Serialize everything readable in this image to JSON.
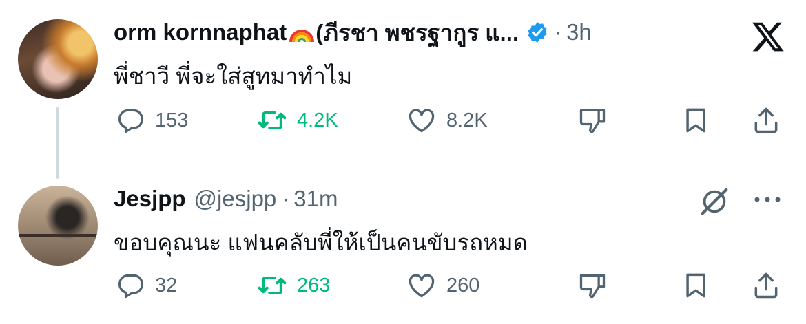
{
  "tweets": [
    {
      "author_name": "orm kornnaphat",
      "author_name_suffix": "(ภีรชา พชรฐากูร แ...",
      "separator": "·",
      "time": "3h",
      "verified": true,
      "text": "พี่ชาวี พี่จะใส่สูทมาทำไม",
      "stats": {
        "replies": "153",
        "reposts": "4.2K",
        "likes": "8.2K"
      }
    },
    {
      "author_name": "Jesjpp",
      "handle": "@jesjpp",
      "separator": "·",
      "time": "31m",
      "text": "ขอบคุณนะ แฟนคลับพี่ให้เป็นคนขับรถหมด",
      "stats": {
        "replies": "32",
        "reposts": "263",
        "likes": "260"
      }
    }
  ],
  "colors": {
    "accent_repost": "#00ba7c",
    "verified": "#1d9bf0",
    "muted": "#536471",
    "thread_line": "#cfd9de"
  },
  "icons": [
    "rainbow-emoji",
    "verified-badge-icon",
    "x-logo-icon",
    "reply-icon",
    "repost-icon",
    "like-icon",
    "dislike-icon",
    "bookmark-icon",
    "share-icon",
    "grok-icon",
    "more-icon"
  ]
}
